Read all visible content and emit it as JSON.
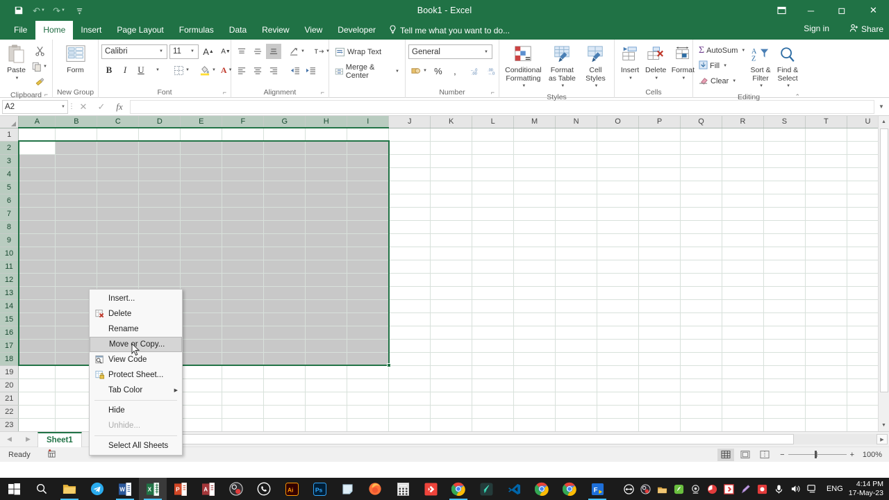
{
  "window": {
    "title": "Book1 - Excel",
    "qat": [
      {
        "name": "save-icon",
        "glyph": "💾"
      },
      {
        "name": "undo-icon",
        "glyph": "↶"
      },
      {
        "name": "redo-icon",
        "glyph": "↷"
      },
      {
        "name": "customize-qat-icon",
        "glyph": "☰"
      }
    ],
    "ribbon_display_options": "⬜",
    "minimize": "─",
    "restore": "❐",
    "close": "✕"
  },
  "tabs": {
    "items": [
      {
        "label": "File",
        "active": false
      },
      {
        "label": "Home",
        "active": true
      },
      {
        "label": "Insert",
        "active": false
      },
      {
        "label": "Page Layout",
        "active": false
      },
      {
        "label": "Formulas",
        "active": false
      },
      {
        "label": "Data",
        "active": false
      },
      {
        "label": "Review",
        "active": false
      },
      {
        "label": "View",
        "active": false
      },
      {
        "label": "Developer",
        "active": false
      }
    ],
    "tell_me": "Tell me what you want to do...",
    "sign_in": "Sign in",
    "share": "Share"
  },
  "ribbon": {
    "groups": [
      {
        "label": "Clipboard"
      },
      {
        "label": "New Group"
      },
      {
        "label": "Font"
      },
      {
        "label": "Alignment"
      },
      {
        "label": "Number"
      },
      {
        "label": "Styles"
      },
      {
        "label": "Cells"
      },
      {
        "label": "Editing"
      }
    ],
    "clipboard": {
      "paste": "Paste",
      "cut": "cut-icon",
      "copy": "copy-icon",
      "format_painter": "format-painter-icon"
    },
    "new_group": {
      "form": "Form"
    },
    "font": {
      "family": "Calibri",
      "size": "11",
      "grow": "A",
      "shrink": "A",
      "bold": "B",
      "italic": "I",
      "underline": "U",
      "borders": "borders-icon",
      "fill_color": "fill-color-icon",
      "font_color": "A"
    },
    "alignment": {
      "wrap_text": "Wrap Text",
      "merge_center": "Merge & Center"
    },
    "number": {
      "format": "General",
      "accounting": "accounting-format-icon",
      "percent": "%",
      "comma": ",",
      "increase_decimal": "increase-decimal-icon",
      "decrease_decimal": "decrease-decimal-icon"
    },
    "styles": {
      "conditional_formatting": "Conditional Formatting",
      "format_as_table": "Format as Table",
      "cell_styles": "Cell Styles"
    },
    "cells": {
      "insert": "Insert",
      "delete": "Delete",
      "format": "Format"
    },
    "editing": {
      "autosum": "AutoSum",
      "fill": "Fill",
      "clear": "Clear",
      "sort_filter": "Sort & Filter",
      "find_select": "Find & Select"
    }
  },
  "formula_bar": {
    "name_box": "A2",
    "cancel": "✕",
    "enter": "✓",
    "insert_function": "fx",
    "formula_value": "",
    "formula_placeholder": ""
  },
  "grid": {
    "columns": [
      "A",
      "B",
      "C",
      "D",
      "E",
      "F",
      "G",
      "H",
      "I",
      "J",
      "K",
      "L",
      "M",
      "N",
      "O",
      "P",
      "Q",
      "R",
      "S",
      "T",
      "U"
    ],
    "rows": [
      1,
      2,
      3,
      4,
      5,
      6,
      7,
      8,
      9,
      10,
      11,
      12,
      13,
      14,
      15,
      16,
      17,
      18,
      19,
      20,
      21,
      22,
      23
    ],
    "selected_columns": [
      "A",
      "B",
      "C",
      "D",
      "E",
      "F",
      "G",
      "H",
      "I"
    ],
    "selected_rows": [
      2,
      3,
      4,
      5,
      6,
      7,
      8,
      9,
      10,
      11,
      12,
      13,
      14,
      15,
      16,
      17,
      18
    ],
    "active_cell": "A2",
    "selection_range": "A2:I18"
  },
  "context_menu": {
    "items": [
      {
        "label": "Insert...",
        "icon": "",
        "state": "normal"
      },
      {
        "label": "Delete",
        "icon": "delete-sheet-icon",
        "state": "normal"
      },
      {
        "label": "Rename",
        "icon": "",
        "state": "normal"
      },
      {
        "label": "Move or Copy...",
        "icon": "",
        "state": "hover"
      },
      {
        "label": "View Code",
        "icon": "view-code-icon",
        "state": "normal"
      },
      {
        "label": "Protect Sheet...",
        "icon": "protect-sheet-icon",
        "state": "normal"
      },
      {
        "label": "Tab Color",
        "icon": "",
        "state": "submenu"
      },
      {
        "label": "Hide",
        "icon": "",
        "state": "normal"
      },
      {
        "label": "Unhide...",
        "icon": "",
        "state": "disabled"
      },
      {
        "label": "Select All Sheets",
        "icon": "",
        "state": "normal"
      }
    ]
  },
  "sheet_tabs": {
    "prev": "◀",
    "next": "▶",
    "tabs": [
      {
        "label": "Sheet1",
        "active": true
      }
    ],
    "add": "⊕"
  },
  "status_bar": {
    "state": "Ready",
    "macro_icon": "record-macro-icon",
    "views": [
      {
        "name": "normal-view",
        "glyph": "☷",
        "active": true
      },
      {
        "name": "page-layout-view",
        "glyph": "▤",
        "active": false
      },
      {
        "name": "page-break-preview",
        "glyph": "▦",
        "active": false
      }
    ],
    "zoom_out": "−",
    "zoom_in": "+",
    "zoom_level": "100%"
  },
  "taskbar": {
    "start": "start-icon",
    "search": "search-icon",
    "apps": [
      {
        "name": "file-explorer-icon",
        "color": "#e8b339",
        "letter": ""
      },
      {
        "name": "telegram-icon",
        "color": "#2aabee",
        "letter": ""
      },
      {
        "name": "word-icon",
        "color": "#2b579a",
        "letter": "W"
      },
      {
        "name": "excel-icon",
        "color": "#217346",
        "letter": "X"
      },
      {
        "name": "powerpoint-icon",
        "color": "#d24726",
        "letter": "P"
      },
      {
        "name": "access-icon",
        "color": "#a4373a",
        "letter": "A"
      },
      {
        "name": "obs-icon",
        "color": "#302e31",
        "letter": ""
      },
      {
        "name": "whatsapp-icon",
        "color": "#25d366",
        "letter": ""
      },
      {
        "name": "illustrator-icon",
        "color": "#330000",
        "letter": "Ai"
      },
      {
        "name": "photoshop-icon",
        "color": "#001e36",
        "letter": "Ps"
      },
      {
        "name": "sticky-notes-icon",
        "color": "#b9d9eb",
        "letter": ""
      },
      {
        "name": "firefox-icon",
        "color": "#ff7139",
        "letter": ""
      },
      {
        "name": "calculator-icon",
        "color": "#ffffff",
        "letter": ""
      },
      {
        "name": "anydesk-icon",
        "color": "#ef443b",
        "letter": ""
      },
      {
        "name": "chrome-icon",
        "color": "#4285f4",
        "letter": ""
      },
      {
        "name": "filmora-icon",
        "color": "#2a3b3a",
        "letter": ""
      },
      {
        "name": "vscode-icon",
        "color": "#0065a9",
        "letter": ""
      },
      {
        "name": "chrome-icon",
        "color": "#4285f4",
        "letter": ""
      },
      {
        "name": "chrome-icon",
        "color": "#4285f4",
        "letter": ""
      },
      {
        "name": "chrome-icon",
        "color": "#4285f4",
        "letter": ""
      },
      {
        "name": "foxit-reader-icon",
        "color": "#1e6fd9",
        "letter": "F"
      }
    ],
    "tray": [
      {
        "name": "teamviewer-tray-icon"
      },
      {
        "name": "obs-tray-icon"
      },
      {
        "name": "idm-tray-icon"
      },
      {
        "name": "green-app-tray-icon"
      },
      {
        "name": "webcam-tray-icon"
      },
      {
        "name": "red-app-tray-icon"
      },
      {
        "name": "anydesk-tray-icon"
      },
      {
        "name": "pen-tray-icon"
      },
      {
        "name": "recorder-tray-icon"
      },
      {
        "name": "microphone-tray-icon"
      },
      {
        "name": "volume-tray-icon"
      },
      {
        "name": "network-tray-icon"
      }
    ],
    "language": "ENG",
    "time": "4:14 PM",
    "date": "17-May-23"
  }
}
